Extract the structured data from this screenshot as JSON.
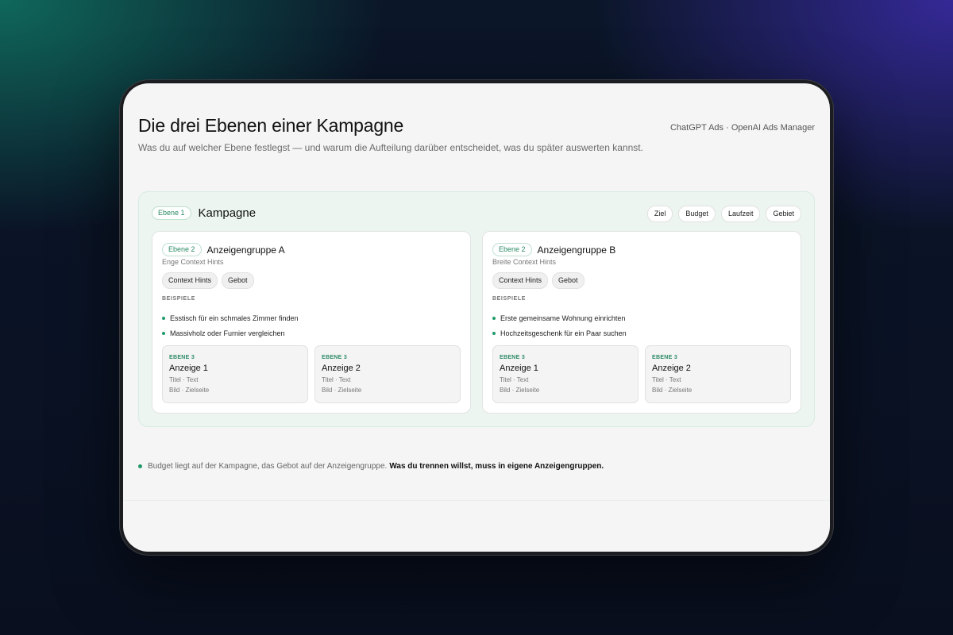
{
  "header": {
    "title": "Die drei Ebenen einer Kampagne",
    "subtitle": "Was du auf welcher Ebene festlegst — und warum die Aufteilung darüber entscheidet, was du später auswerten kannst.",
    "brand": "ChatGPT Ads · OpenAI Ads Manager"
  },
  "campaign": {
    "level": "Ebene 1",
    "title": "Kampagne",
    "tags": [
      "Ziel",
      "Budget",
      "Laufzeit",
      "Gebiet"
    ]
  },
  "groups": [
    {
      "level": "Ebene 2",
      "title": "Anzeigengruppe A",
      "subtitle": "Enge Context Hints",
      "tags": [
        "Context Hints",
        "Gebot"
      ],
      "examples_label": "BEISPIELE",
      "examples": [
        "Esstisch für ein schmales Zimmer finden",
        "Massivholz oder Furnier vergleichen"
      ],
      "ads": [
        {
          "level": "EBENE 3",
          "name": "Anzeige 1",
          "line1": "Titel · Text",
          "line2": "Bild · Zielseite"
        },
        {
          "level": "EBENE 3",
          "name": "Anzeige 2",
          "line1": "Titel · Text",
          "line2": "Bild · Zielseite"
        }
      ]
    },
    {
      "level": "Ebene 2",
      "title": "Anzeigengruppe B",
      "subtitle": "Breite Context Hints",
      "tags": [
        "Context Hints",
        "Gebot"
      ],
      "examples_label": "BEISPIELE",
      "examples": [
        "Erste gemeinsame Wohnung einrichten",
        "Hochzeitsgeschenk für ein Paar suchen"
      ],
      "ads": [
        {
          "level": "EBENE 3",
          "name": "Anzeige 1",
          "line1": "Titel · Text",
          "line2": "Bild · Zielseite"
        },
        {
          "level": "EBENE 3",
          "name": "Anzeige 2",
          "line1": "Titel · Text",
          "line2": "Bild · Zielseite"
        }
      ]
    }
  ],
  "footer": {
    "note": "Budget liegt auf der Kampagne, das Gebot auf der Anzeigengruppe.",
    "note_strong": "Was du trennen willst, muss in eigene Anzeigengruppen."
  },
  "colors": {
    "accent": "#1f9a6a",
    "campaign_bg": "#ecf5f0",
    "screen_bg": "#f5f5f5"
  }
}
